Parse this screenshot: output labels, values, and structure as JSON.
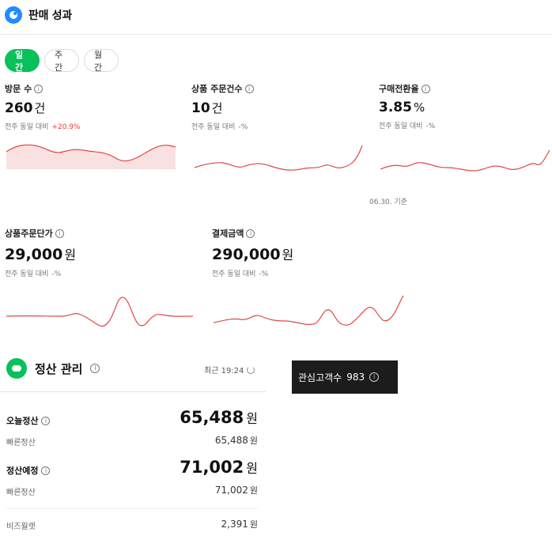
{
  "header": {
    "title": "판매 성과"
  },
  "tabs": [
    {
      "label": "일간",
      "active": true
    },
    {
      "label": "주간",
      "active": false
    },
    {
      "label": "월간",
      "active": false
    }
  ],
  "metrics": [
    {
      "label": "방문 수",
      "value": "260",
      "unit": "건",
      "compare_label": "전주 동일 대비",
      "delta": "+20.9%"
    },
    {
      "label": "상품 주문건수",
      "value": "10",
      "unit": "건",
      "compare_label": "전주 동일 대비",
      "delta": "-%"
    },
    {
      "label": "구매전환율",
      "value": "3.85",
      "unit": "%",
      "compare_label": "전주 동일 대비",
      "delta": "-%"
    },
    {
      "label": "상품주문단가",
      "value": "29,000",
      "unit": "원",
      "compare_label": "전주 동일 대비",
      "delta": "-%"
    },
    {
      "label": "결제금액",
      "value": "290,000",
      "unit": "원",
      "compare_label": "전주 동일 대비",
      "delta": "-%"
    }
  ],
  "as_of": "06.30. 기준",
  "settlement": {
    "title": "정산 관리",
    "updated": "최근 19:24",
    "today_label": "오늘정산",
    "today_value": "65,488",
    "today_sub_label": "빠른정산",
    "today_sub_value": "65,488",
    "scheduled_label": "정산예정",
    "scheduled_value": "71,002",
    "scheduled_sub_label": "빠른정산",
    "scheduled_sub_value": "71,002",
    "bizwallet_label": "비즈월렛",
    "bizwallet_value": "2,391",
    "unit": "원"
  },
  "tooltip": {
    "label": "관심고객수",
    "value": "983"
  },
  "colors": {
    "spark_line": "#e04848",
    "spark_fill": "#f7d4d4",
    "accent_green": "#09c05a",
    "accent_blue": "#1f8bff"
  },
  "icons": {
    "section_logo": "pie-logo-icon",
    "settlement_logo": "wallet-logo-icon",
    "info": "info-icon",
    "refresh": "refresh-icon"
  }
}
